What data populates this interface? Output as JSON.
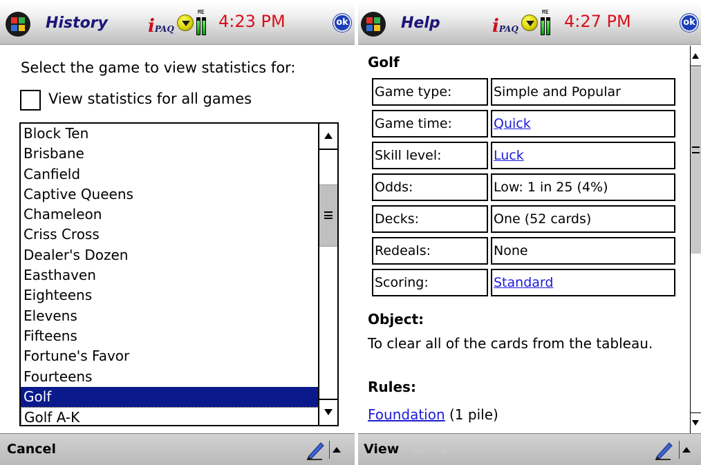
{
  "left_window": {
    "title": "History",
    "clock": "4:23 PM",
    "ok_label": "ok",
    "prompt": "Select the game to view statistics for:",
    "all_games_checkbox": {
      "label": "View statistics for all games",
      "checked": false
    },
    "games": [
      "Block Ten",
      "Brisbane",
      "Canfield",
      "Captive Queens",
      "Chameleon",
      "Criss Cross",
      "Dealer's Dozen",
      "Easthaven",
      "Eighteens",
      "Elevens",
      "Fifteens",
      "Fortune's Favor",
      "Fourteens",
      "Golf",
      "Golf A-K"
    ],
    "selected_game": "Golf",
    "menu": {
      "left_label": "Cancel"
    }
  },
  "right_window": {
    "title": "Help",
    "clock": "4:27 PM",
    "ok_label": "ok",
    "heading": "Golf",
    "table": [
      {
        "key": "Game type:",
        "value": "Simple and Popular",
        "link": false
      },
      {
        "key": "Game time:",
        "value": "Quick",
        "link": true
      },
      {
        "key": "Skill level:",
        "value": "Luck",
        "link": true
      },
      {
        "key": "Odds:",
        "value": "Low: 1 in 25 (4%)",
        "link": false
      },
      {
        "key": "Decks:",
        "value": "One (52 cards)",
        "link": false
      },
      {
        "key": "Redeals:",
        "value": "None",
        "link": false
      },
      {
        "key": "Scoring:",
        "value": "Standard",
        "link": true
      }
    ],
    "object_title": "Object:",
    "object_text": "To clear all of the cards from the tableau.",
    "rules_title": "Rules:",
    "rules_link": "Foundation",
    "rules_text": "(1 pile)",
    "menu": {
      "left_label": "View"
    }
  },
  "branding": {
    "logo_prefix": "i",
    "logo_text": "PAQ"
  },
  "colors": {
    "selection": "#0a1a8c",
    "link": "#1b1bd9",
    "clock": "#d8101a",
    "title": "#1c1478"
  },
  "icons": [
    "windows-start-icon",
    "volume-icon",
    "signal-icon",
    "ok-button",
    "pen-icon",
    "sip-arrow-icon",
    "back-arrow-icon",
    "forward-arrow-icon"
  ]
}
